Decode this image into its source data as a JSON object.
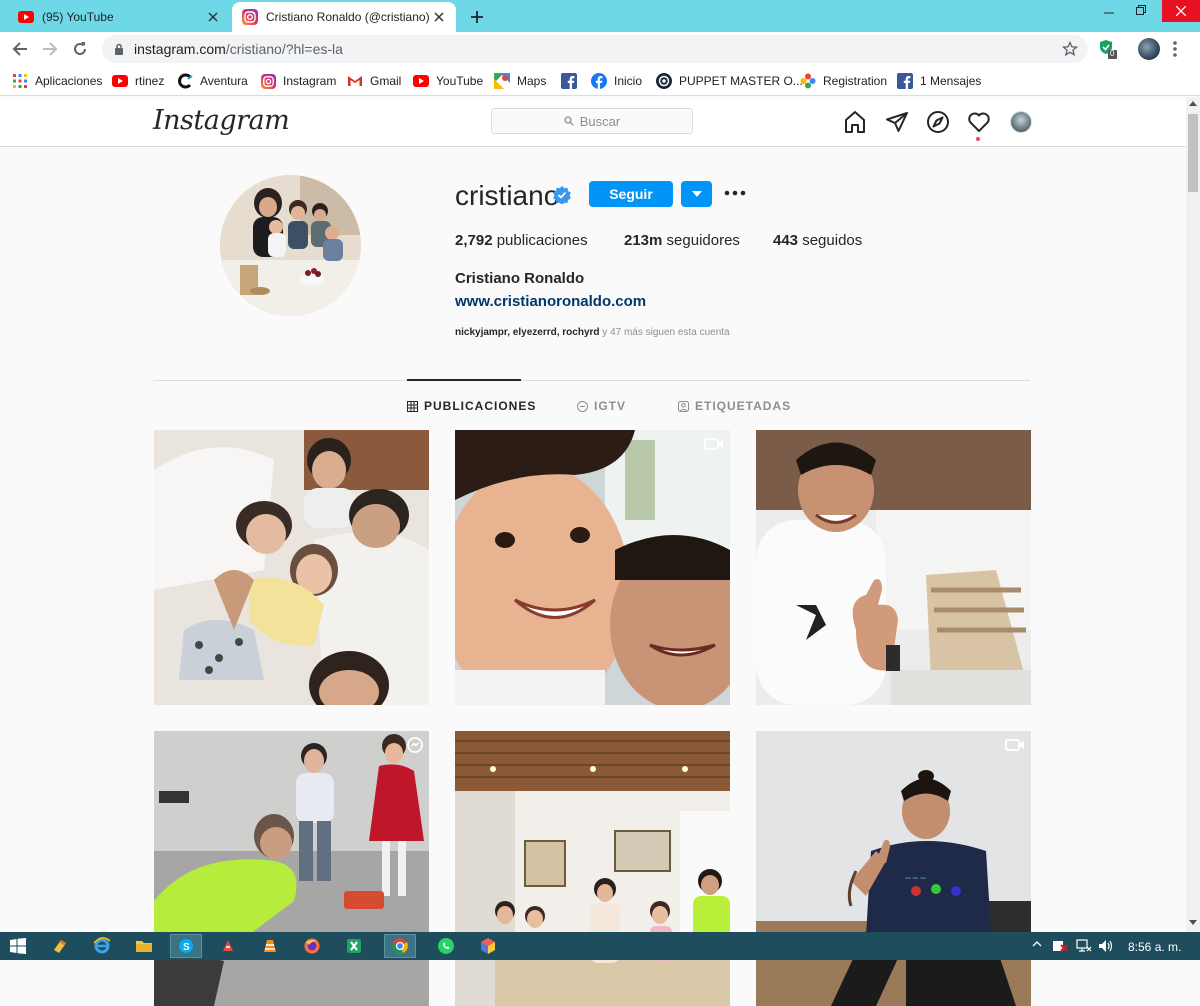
{
  "browser": {
    "tabs": [
      {
        "title": "(95) YouTube",
        "active": false
      },
      {
        "title": "Cristiano Ronaldo (@cristiano) • I",
        "active": true
      }
    ],
    "url_host": "instagram.com",
    "url_path": "/cristiano/?hl=es-la",
    "extension_badge": "0",
    "bookmarks": [
      {
        "label": "Aplicaciones",
        "icon": "apps-grid-icon"
      },
      {
        "label": "rtinez",
        "icon": "youtube-icon"
      },
      {
        "label": "Aventura",
        "icon": "c-logo-icon"
      },
      {
        "label": "Instagram",
        "icon": "instagram-icon"
      },
      {
        "label": "Gmail",
        "icon": "gmail-icon"
      },
      {
        "label": "YouTube",
        "icon": "youtube-icon"
      },
      {
        "label": "Maps",
        "icon": "maps-icon"
      },
      {
        "label": "",
        "icon": "facebook-icon"
      },
      {
        "label": "Inicio",
        "icon": "facebook-round-icon"
      },
      {
        "label": "PUPPET MASTER O...",
        "icon": "steam-icon"
      },
      {
        "label": "Registration",
        "icon": "pinwheel-icon"
      },
      {
        "label": "1 Mensajes",
        "icon": "facebook-icon"
      }
    ]
  },
  "instagram": {
    "logo": "Instagram",
    "search_placeholder": "Buscar",
    "profile": {
      "username": "cristiano",
      "follow_label": "Seguir",
      "posts_count": "2,792",
      "posts_label": "publicaciones",
      "followers_count": "213m",
      "followers_label": "seguidores",
      "following_count": "443",
      "following_label": "seguidos",
      "full_name": "Cristiano Ronaldo",
      "website": "www.cristianoronaldo.com",
      "followed_by_names": "nickyjampr, elyezerrd, rochyrd",
      "followed_by_rest": " y 47 más siguen esta cuenta"
    },
    "tabs": [
      {
        "label": "PUBLICACIONES",
        "icon": "grid-icon",
        "active": true
      },
      {
        "label": "IGTV",
        "icon": "igtv-icon",
        "active": false
      },
      {
        "label": "ETIQUETADAS",
        "icon": "tagged-icon",
        "active": false
      }
    ],
    "posts": [
      {
        "type": "photo",
        "badge": ""
      },
      {
        "type": "video",
        "badge": "video-icon"
      },
      {
        "type": "photo",
        "badge": ""
      },
      {
        "type": "igtv",
        "badge": "igtv-icon"
      },
      {
        "type": "photo",
        "badge": ""
      },
      {
        "type": "video",
        "badge": "video-icon"
      }
    ]
  },
  "taskbar": {
    "clock": "8:56 a. m."
  },
  "colors": {
    "tabbar": "#6ed8e6",
    "follow_button": "#0095f6",
    "link": "#00376b",
    "taskbar": "#1e4d5e"
  }
}
